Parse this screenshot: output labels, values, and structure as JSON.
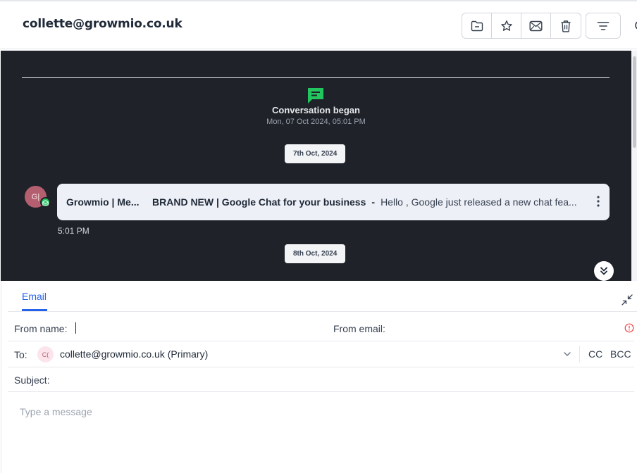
{
  "header": {
    "title": "collette@growmio.co.uk",
    "actions": [
      {
        "name": "move-to-folder",
        "icon": "folder-icon"
      },
      {
        "name": "star",
        "icon": "star-icon"
      },
      {
        "name": "mark-unread",
        "icon": "envelope-icon"
      },
      {
        "name": "delete",
        "icon": "trash-icon"
      }
    ],
    "filter_icon": "filter-lines-icon"
  },
  "conversation": {
    "began_title": "Conversation began",
    "began_date": "Mon, 07 Oct 2024, 05:01 PM",
    "date_chip_1": "7th Oct, 2024",
    "date_chip_2": "8th Oct, 2024",
    "message": {
      "avatar_initials": "G|",
      "sender": "Growmio | Me...",
      "subject": "BRAND NEW | Google Chat for your business",
      "separator": "-",
      "preview": "Hello , Google just released a new chat fea...",
      "time": "5:01 PM"
    }
  },
  "composer": {
    "tab_email": "Email",
    "from_name_label": "From name:",
    "from_email_label": "From email:",
    "to_label": "To:",
    "to_avatar": "C(",
    "to_value": "collette@growmio.co.uk (Primary)",
    "cc": "CC",
    "bcc": "BCC",
    "subject_label": "Subject:",
    "message_placeholder": "Type a message"
  },
  "colors": {
    "accent": "#2563eb",
    "conversation_bg": "#1f2329",
    "began_icon": "#22c55e",
    "avatar": "#b45f70",
    "warning": "#ef4444"
  }
}
